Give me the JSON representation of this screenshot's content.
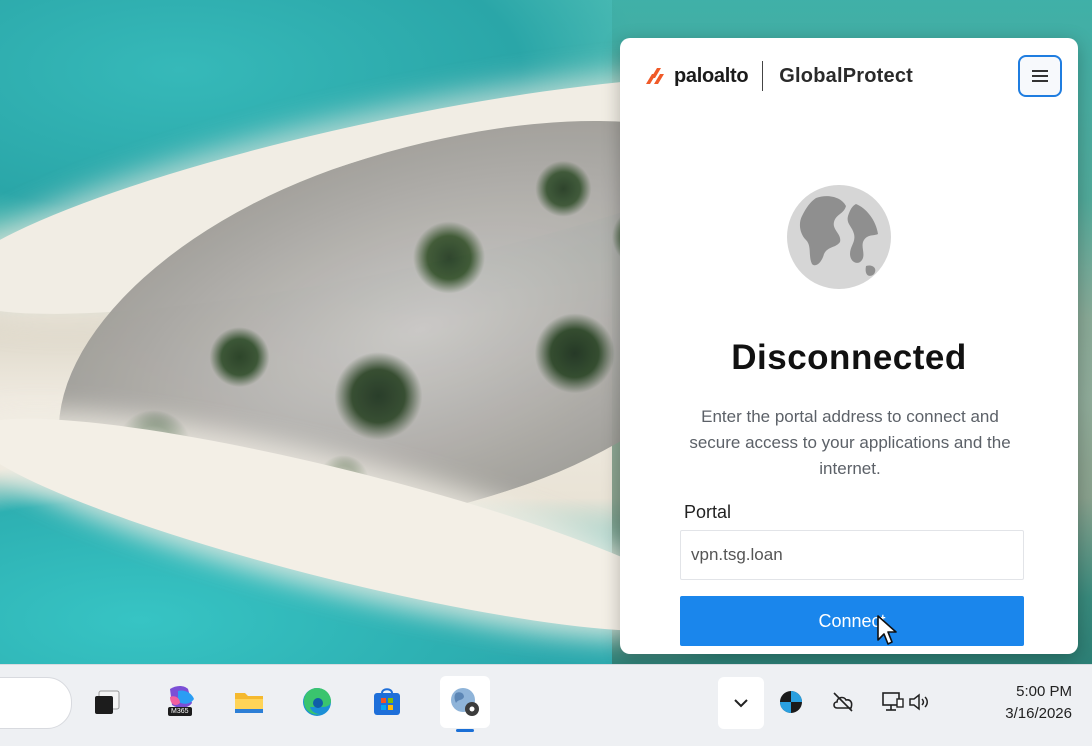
{
  "app": {
    "brand": "paloalto",
    "product": "GlobalProtect"
  },
  "status": {
    "title": "Disconnected",
    "description": "Enter the portal address to connect and secure access to your applications and the internet."
  },
  "portal": {
    "label": "Portal",
    "value": "vpn.tsg.loan"
  },
  "connect_label": "Connect",
  "clock": {
    "time": "5:00 PM",
    "date": "3/16/2026"
  },
  "taskbar": {
    "m365_badge": "M365",
    "apps": [
      "task-view",
      "microsoft-365-copilot",
      "file-explorer",
      "edge",
      "microsoft-store",
      "globalprotect"
    ]
  },
  "colors": {
    "accent": "#1a86ec",
    "brand_orange": "#f05a28",
    "menu_border": "#1f7de0"
  }
}
